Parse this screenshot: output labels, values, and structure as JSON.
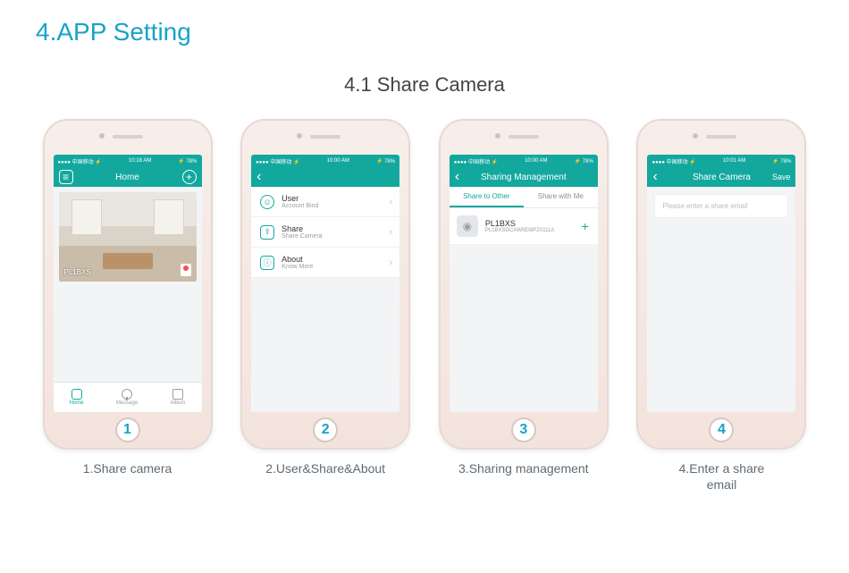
{
  "section_title": "4.APP Setting",
  "section_subtitle": "4.1 Share Camera",
  "status": {
    "carrier": "●●●● 中国移动 ⚡",
    "battery": "⚡ 78%"
  },
  "phones": [
    {
      "time": "10:18 AM",
      "header_title": "Home",
      "header_left_icon": "menu",
      "header_right_icon": "add",
      "camera_label": "PL1BXS",
      "tabs": {
        "home": "Home",
        "message": "Message",
        "album": "Album"
      },
      "step_number": "1",
      "caption": "1.Share camera"
    },
    {
      "time": "10:00 AM",
      "header_title": "",
      "header_left_icon": "back",
      "items": [
        {
          "title": "User",
          "subtitle": "Account Bind"
        },
        {
          "title": "Share",
          "subtitle": "Share Camera"
        },
        {
          "title": "About",
          "subtitle": "Know More"
        }
      ],
      "step_number": "2",
      "caption": "2.User&Share&About"
    },
    {
      "time": "10:00 AM",
      "header_title": "Sharing Management",
      "header_left_icon": "back",
      "subtabs": {
        "left": "Share to Other",
        "right": "Share with Me"
      },
      "device": {
        "name": "PL1BXS",
        "uid": "PL1BXSGCAW0EMPZ0111A"
      },
      "step_number": "3",
      "caption": "3.Sharing management"
    },
    {
      "time": "10:01 AM",
      "header_title": "Share Camera",
      "header_left_icon": "back",
      "header_right_text": "Save",
      "placeholder": "Please enter a share email",
      "step_number": "4",
      "caption": "4.Enter a share\nemail"
    }
  ]
}
